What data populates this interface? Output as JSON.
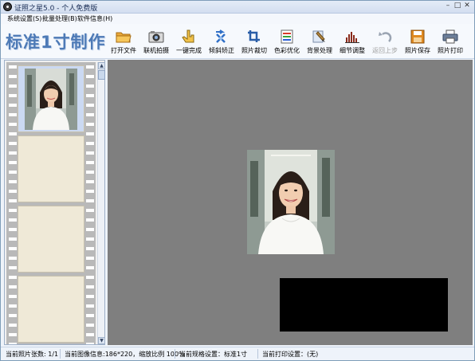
{
  "window": {
    "title": "证照之星5.0 - 个人免费版",
    "controls": {
      "minimize": "–",
      "maximize": "□",
      "close": "✕"
    }
  },
  "menu": [
    {
      "label": "系统设置(S)"
    },
    {
      "label": "批量处理(B)"
    },
    {
      "label": "软件信息(H)"
    }
  ],
  "logo": "标准1寸制作",
  "toolbar": [
    {
      "label": "打开文件",
      "icon": "folder-icon",
      "enabled": true
    },
    {
      "label": "联机拍摄",
      "icon": "camera-icon",
      "enabled": true
    },
    {
      "label": "一键完成",
      "icon": "hand-pointer-icon",
      "enabled": true
    },
    {
      "label": "倾斜矫正",
      "icon": "rotate-arrows-icon",
      "enabled": true
    },
    {
      "label": "照片裁切",
      "icon": "crop-icon",
      "enabled": true
    },
    {
      "label": "色彩优化",
      "icon": "color-bars-icon",
      "enabled": true
    },
    {
      "label": "背景处理",
      "icon": "brush-icon",
      "enabled": true
    },
    {
      "label": "细节调整",
      "icon": "histogram-icon",
      "enabled": true
    },
    {
      "label": "返回上步",
      "icon": "undo-icon",
      "enabled": false
    },
    {
      "label": "照片保存",
      "icon": "floppy-disk-icon",
      "enabled": true
    },
    {
      "label": "照片打印",
      "icon": "printer-icon",
      "enabled": true
    }
  ],
  "status": {
    "photo_count": "当前照片张数: 1/1",
    "image_info": "当前图像信息:186*220，缩放比例 100%",
    "spec": "当前规格设置：标准1寸",
    "print": "当前打印设置：(无)"
  },
  "colors": {
    "accent": "#4d7ab6",
    "workspace_bg": "#7f7f7f",
    "film_frame": "#efe9d7"
  }
}
